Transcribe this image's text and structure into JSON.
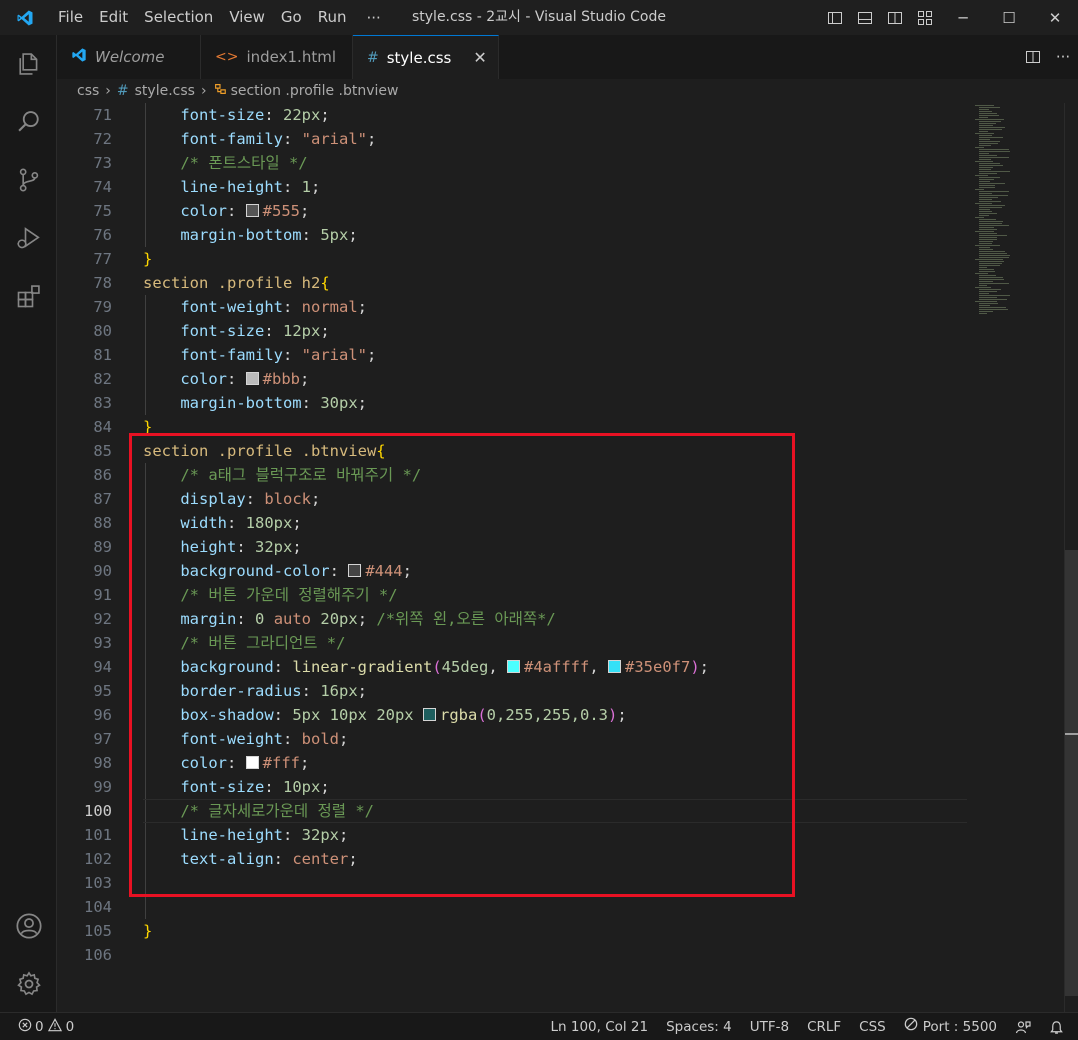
{
  "window": {
    "title": "style.css - 2교시 - Visual Studio Code",
    "minimize": "─",
    "maximize": "☐",
    "close": "✕"
  },
  "menu": [
    "File",
    "Edit",
    "Selection",
    "View",
    "Go",
    "Run"
  ],
  "menu_more": "···",
  "tabs": [
    {
      "label": "Welcome",
      "icon": "vscode-icon",
      "active": false
    },
    {
      "label": "index1.html",
      "icon": "html-icon",
      "active": false
    },
    {
      "label": "style.css",
      "icon": "hash-icon",
      "active": true
    }
  ],
  "tab_close": "✕",
  "tab_more": "···",
  "breadcrumb": {
    "folder": "css",
    "file": "style.css",
    "symbol": "section .profile .btnview"
  },
  "line_numbers": [
    "71",
    "72",
    "73",
    "74",
    "75",
    "76",
    "77",
    "78",
    "79",
    "80",
    "81",
    "82",
    "83",
    "84",
    "85",
    "86",
    "87",
    "88",
    "89",
    "90",
    "91",
    "92",
    "93",
    "94",
    "95",
    "96",
    "97",
    "98",
    "99",
    "100",
    "101",
    "102",
    "103",
    "104",
    "105",
    "106"
  ],
  "current_line": "100",
  "code": {
    "l71": {
      "prop": "font-size",
      "num": "22px"
    },
    "l72": {
      "prop": "font-family",
      "str": "\"arial\""
    },
    "l73": {
      "cmt": "/* 폰트스타일 */"
    },
    "l74": {
      "prop": "line-height",
      "num": "1"
    },
    "l75": {
      "prop": "color",
      "val": "#555",
      "swatch": "#555555"
    },
    "l76": {
      "prop": "margin-bottom",
      "num": "5px"
    },
    "l77": {
      "brace": "}"
    },
    "l78": {
      "sel": "section .profile h2",
      "brace": "{"
    },
    "l79": {
      "prop": "font-weight",
      "val": "normal"
    },
    "l80": {
      "prop": "font-size",
      "num": "12px"
    },
    "l81": {
      "prop": "font-family",
      "str": "\"arial\""
    },
    "l82": {
      "prop": "color",
      "val": "#bbb",
      "swatch": "#bbbbbb"
    },
    "l83": {
      "prop": "margin-bottom",
      "num": "30px"
    },
    "l84": {
      "brace": "}"
    },
    "l85": {
      "sel": "section .profile .btnview",
      "brace": "{"
    },
    "l86": {
      "cmt": "/* a태그 블럭구조로 바꿔주기 */"
    },
    "l87": {
      "prop": "display",
      "val": "block"
    },
    "l88": {
      "prop": "width",
      "num": "180px"
    },
    "l89": {
      "prop": "height",
      "num": "32px"
    },
    "l90": {
      "prop": "background-color",
      "val": "#444",
      "swatch": "#444444"
    },
    "l91": {
      "cmt": "/* 버튼 가운데 정렬해주기 */"
    },
    "l92": {
      "prop": "margin",
      "num1": "0",
      "val": "auto",
      "num2": "20px",
      "cmt": "/*위쪽 왼,오른 아래쪽*/"
    },
    "l93": {
      "cmt": "/* 버튼 그라디언트 */"
    },
    "l94": {
      "prop": "background",
      "fn": "linear-gradient",
      "num": "45deg",
      "val1": "#4affff",
      "swatch1": "#4affff",
      "val2": "#35e0f7",
      "swatch2": "#35e0f7"
    },
    "l95": {
      "prop": "border-radius",
      "num": "16px"
    },
    "l96": {
      "prop": "box-shadow",
      "nums": "5px 10px 20px",
      "fn": "rgba",
      "args": "0,255,255,0.3",
      "swatch": "#1e5e5e"
    },
    "l97": {
      "prop": "font-weight",
      "val": "bold"
    },
    "l98": {
      "prop": "color",
      "val": "#fff",
      "swatch": "#ffffff"
    },
    "l99": {
      "prop": "font-size",
      "num": "10px"
    },
    "l100": {
      "cmt": "/* 글자세로가운데 정렬 */"
    },
    "l101": {
      "prop": "line-height",
      "num": "32px"
    },
    "l102": {
      "prop": "text-align",
      "val": "center"
    },
    "l105": {
      "brace": "}"
    }
  },
  "status": {
    "errors": "0",
    "warnings": "0",
    "position": "Ln 100, Col 21",
    "spaces": "Spaces: 4",
    "encoding": "UTF-8",
    "eol": "CRLF",
    "language": "CSS",
    "port": "Port : 5500"
  },
  "colors": {
    "accent": "#0078d4",
    "highlight_box": "#e81123",
    "vscode_blue": "#23a7f2"
  }
}
